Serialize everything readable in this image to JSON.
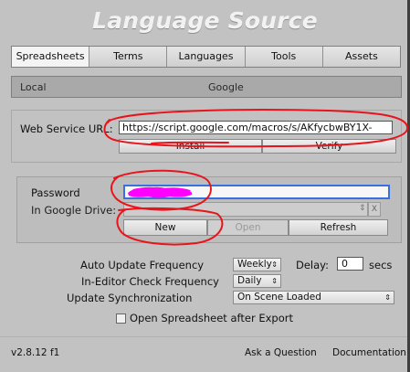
{
  "header": {
    "title": "Language Source"
  },
  "tabs": [
    {
      "label": "Spreadsheets",
      "active": true
    },
    {
      "label": "Terms",
      "active": false
    },
    {
      "label": "Languages",
      "active": false
    },
    {
      "label": "Tools",
      "active": false
    },
    {
      "label": "Assets",
      "active": false
    }
  ],
  "source": {
    "local_label": "Local",
    "google_label": "Google"
  },
  "web_service": {
    "label": "Web Service URL:",
    "value": "https://script.google.com/macros/s/AKfycbwBY1X-",
    "install_label": "Install",
    "verify_label": "Verify"
  },
  "credentials": {
    "password_label": "Password",
    "google_drive_label": "In Google Drive:",
    "clear_symbol": "X",
    "new_label": "New",
    "open_label": "Open",
    "refresh_label": "Refresh"
  },
  "settings": {
    "auto_update_label": "Auto Update Frequency",
    "auto_update_value": "Weekly",
    "delay_label": "Delay:",
    "delay_value": "0",
    "secs_label": "secs",
    "editor_check_label": "In-Editor Check Frequency",
    "editor_check_value": "Daily",
    "sync_label": "Update Synchronization",
    "sync_value": "On Scene Loaded",
    "open_after_export_label": "Open Spreadsheet after Export",
    "open_after_export_checked": false
  },
  "footer": {
    "version": "v2.8.12 f1",
    "ask_label": "Ask a Question",
    "docs_label": "Documentation"
  },
  "colors": {
    "background": "#c2c2c2",
    "annotation_red": "#e8141b",
    "redaction_magenta": "#ff00ff",
    "focus_blue": "#3a6fe0"
  }
}
